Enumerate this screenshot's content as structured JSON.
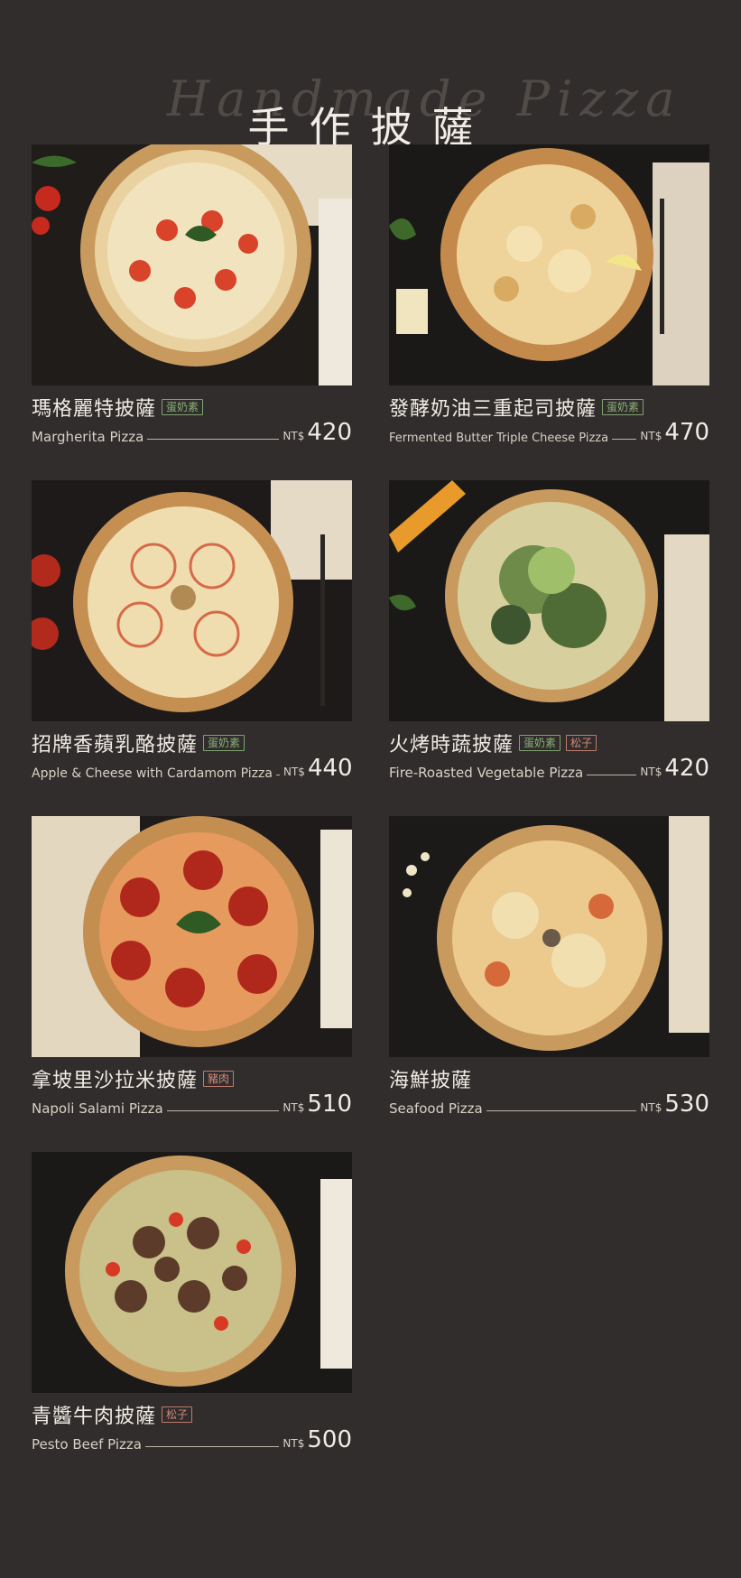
{
  "header": {
    "title": "手作披薩",
    "script_text": "Handmade Pizza"
  },
  "currency": "NT$",
  "items": [
    {
      "zh": "瑪格麗特披薩",
      "en": "Margherita Pizza",
      "price": "420",
      "tags": [
        {
          "label": "蛋奶素",
          "color": "green"
        }
      ]
    },
    {
      "zh": "發酵奶油三重起司披薩",
      "en": "Fermented Butter Triple Cheese Pizza",
      "price": "470",
      "tags": [
        {
          "label": "蛋奶素",
          "color": "green"
        }
      ]
    },
    {
      "zh": "招牌香蘋乳酪披薩",
      "en": "Apple & Cheese with Cardamom Pizza",
      "price": "440",
      "tags": [
        {
          "label": "蛋奶素",
          "color": "green"
        }
      ]
    },
    {
      "zh": "火烤時蔬披薩",
      "en": "Fire-Roasted Vegetable Pizza",
      "price": "420",
      "tags": [
        {
          "label": "蛋奶素",
          "color": "green"
        },
        {
          "label": "松子",
          "color": "red"
        }
      ]
    },
    {
      "zh": "拿坡里沙拉米披薩",
      "en": "Napoli Salami Pizza",
      "price": "510",
      "tags": [
        {
          "label": "豬肉",
          "color": "red"
        }
      ]
    },
    {
      "zh": "海鮮披薩",
      "en": "Seafood Pizza",
      "price": "530",
      "tags": []
    },
    {
      "zh": "青醬牛肉披薩",
      "en": "Pesto Beef Pizza",
      "price": "500",
      "tags": [
        {
          "label": "松子",
          "color": "red"
        }
      ]
    }
  ],
  "colors": {
    "background": "#302d2c",
    "tag_green": "#8ab07a",
    "tag_red": "#d08a7c"
  }
}
